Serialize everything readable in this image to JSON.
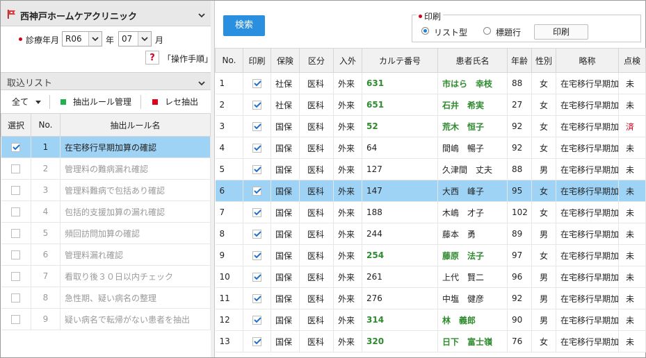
{
  "clinic": {
    "name": "西神戸ホームケアクリニック"
  },
  "date_filter": {
    "label": "診療年月",
    "era": "R06",
    "year_suffix": "年",
    "month": "07",
    "month_suffix": "月"
  },
  "manual_link": "「操作手順」",
  "help_icon": "?",
  "import_list": {
    "title": "取込リスト"
  },
  "toolbar": {
    "all_label": "全て",
    "rule_manage": "抽出ルール管理",
    "rece_extract": "レセ抽出",
    "green": "#22b14c",
    "red": "#e0001b"
  },
  "rule_table": {
    "headers": [
      "選択",
      "No.",
      "抽出ルール名"
    ],
    "rows": [
      {
        "no": "1",
        "name": "在宅移行早期加算の確認",
        "checked": true,
        "selected": true
      },
      {
        "no": "2",
        "name": "管理料の難病漏れ確認",
        "checked": false,
        "selected": false
      },
      {
        "no": "3",
        "name": "管理料難病で包括あり確認",
        "checked": false,
        "selected": false
      },
      {
        "no": "4",
        "name": "包括的支援加算の漏れ確認",
        "checked": false,
        "selected": false
      },
      {
        "no": "5",
        "name": "頻回訪問加算の確認",
        "checked": false,
        "selected": false
      },
      {
        "no": "6",
        "name": "管理料漏れ確認",
        "checked": false,
        "selected": false
      },
      {
        "no": "7",
        "name": "看取り後３０日以内チェック",
        "checked": false,
        "selected": false
      },
      {
        "no": "8",
        "name": "急性期、疑い病名の整理",
        "checked": false,
        "selected": false
      },
      {
        "no": "9",
        "name": "疑い病名で転帰がない患者を抽出",
        "checked": false,
        "selected": false
      }
    ]
  },
  "search_button": "検索",
  "print_group": {
    "legend": "印刷",
    "opt_list": "リスト型",
    "opt_label": "標題行",
    "button": "印刷"
  },
  "patient_table": {
    "headers": [
      "No.",
      "印刷",
      "保険",
      "区分",
      "入外",
      "カルテ番号",
      "患者氏名",
      "年齢",
      "性別",
      "略称",
      "点検"
    ],
    "rows": [
      {
        "no": "1",
        "ins": "社保",
        "kubun": "医科",
        "io": "外来",
        "karte": "631",
        "name": "市はら　幸枝",
        "age": "88",
        "sex": "女",
        "abbr": "在宅移行早期加",
        "check": "未",
        "hl": true,
        "sel": false,
        "red": false
      },
      {
        "no": "2",
        "ins": "社保",
        "kubun": "医科",
        "io": "外来",
        "karte": "651",
        "name": "石井　希実",
        "age": "27",
        "sex": "女",
        "abbr": "在宅移行早期加",
        "check": "未",
        "hl": true,
        "sel": false,
        "red": false
      },
      {
        "no": "3",
        "ins": "国保",
        "kubun": "医科",
        "io": "外来",
        "karte": "52",
        "name": "荒木　恒子",
        "age": "92",
        "sex": "女",
        "abbr": "在宅移行早期加",
        "check": "済",
        "hl": true,
        "sel": false,
        "red": true
      },
      {
        "no": "4",
        "ins": "国保",
        "kubun": "医科",
        "io": "外来",
        "karte": "64",
        "name": "間嶋　暢子",
        "age": "92",
        "sex": "女",
        "abbr": "在宅移行早期加",
        "check": "未",
        "hl": false,
        "sel": false,
        "red": false
      },
      {
        "no": "5",
        "ins": "国保",
        "kubun": "医科",
        "io": "外来",
        "karte": "127",
        "name": "久津間　丈夫",
        "age": "88",
        "sex": "男",
        "abbr": "在宅移行早期加",
        "check": "未",
        "hl": false,
        "sel": false,
        "red": false
      },
      {
        "no": "6",
        "ins": "国保",
        "kubun": "医科",
        "io": "外来",
        "karte": "147",
        "name": "大西　峰子",
        "age": "95",
        "sex": "女",
        "abbr": "在宅移行早期加",
        "check": "未",
        "hl": false,
        "sel": true,
        "red": false
      },
      {
        "no": "7",
        "ins": "国保",
        "kubun": "医科",
        "io": "外来",
        "karte": "188",
        "name": "木嶋　才子",
        "age": "102",
        "sex": "女",
        "abbr": "在宅移行早期加",
        "check": "未",
        "hl": false,
        "sel": false,
        "red": false
      },
      {
        "no": "8",
        "ins": "国保",
        "kubun": "医科",
        "io": "外来",
        "karte": "244",
        "name": "藤本　勇",
        "age": "89",
        "sex": "男",
        "abbr": "在宅移行早期加",
        "check": "未",
        "hl": false,
        "sel": false,
        "red": false
      },
      {
        "no": "9",
        "ins": "国保",
        "kubun": "医科",
        "io": "外来",
        "karte": "254",
        "name": "藤原　法子",
        "age": "97",
        "sex": "女",
        "abbr": "在宅移行早期加",
        "check": "未",
        "hl": true,
        "sel": false,
        "red": false
      },
      {
        "no": "10",
        "ins": "国保",
        "kubun": "医科",
        "io": "外来",
        "karte": "261",
        "name": "上代　賢二",
        "age": "96",
        "sex": "男",
        "abbr": "在宅移行早期加",
        "check": "未",
        "hl": false,
        "sel": false,
        "red": false
      },
      {
        "no": "11",
        "ins": "国保",
        "kubun": "医科",
        "io": "外来",
        "karte": "276",
        "name": "中塩　健彦",
        "age": "92",
        "sex": "男",
        "abbr": "在宅移行早期加",
        "check": "未",
        "hl": false,
        "sel": false,
        "red": false
      },
      {
        "no": "12",
        "ins": "国保",
        "kubun": "医科",
        "io": "外来",
        "karte": "314",
        "name": "林　義郎",
        "age": "90",
        "sex": "男",
        "abbr": "在宅移行早期加",
        "check": "未",
        "hl": true,
        "sel": false,
        "red": false
      },
      {
        "no": "13",
        "ins": "国保",
        "kubun": "医科",
        "io": "外来",
        "karte": "320",
        "name": "日下　富士嶺",
        "age": "76",
        "sex": "女",
        "abbr": "在宅移行早期加",
        "check": "未",
        "hl": true,
        "sel": false,
        "red": false
      }
    ]
  }
}
